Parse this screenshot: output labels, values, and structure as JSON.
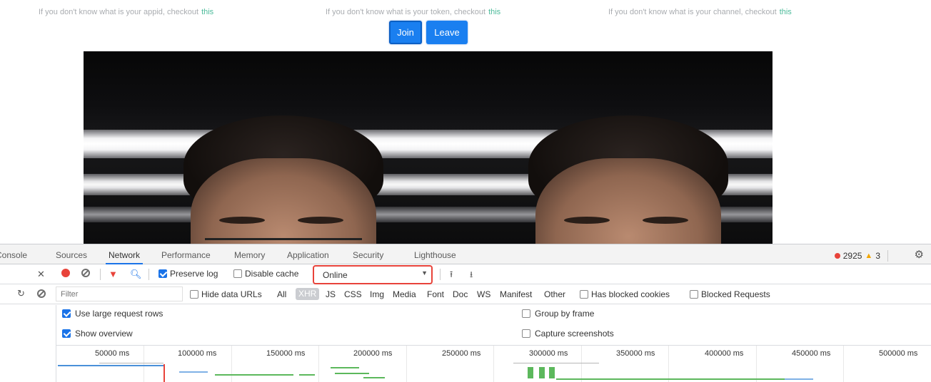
{
  "hints": {
    "appid": {
      "text": "If you don't know what is your appid, checkout",
      "link": "this"
    },
    "token": {
      "text": "If you don't know what is your token, checkout",
      "link": "this"
    },
    "channel": {
      "text": "If you don't know what is your channel, checkout",
      "link": "this"
    }
  },
  "buttons": {
    "join": "Join",
    "leave": "Leave"
  },
  "devtools": {
    "tabs": [
      "Console",
      "Sources",
      "Network",
      "Performance",
      "Memory",
      "Application",
      "Security",
      "Lighthouse"
    ],
    "active_tab": "Network",
    "errors": "2925",
    "warnings": "3",
    "toolbar": {
      "preserve_log": "Preserve log",
      "preserve_log_checked": true,
      "disable_cache": "Disable cache",
      "disable_cache_checked": false,
      "throttling": "Online"
    },
    "filterbar": {
      "filter_placeholder": "Filter",
      "hide_data_urls": "Hide data URLs",
      "types": [
        "All",
        "XHR",
        "JS",
        "CSS",
        "Img",
        "Media",
        "Font",
        "Doc",
        "WS",
        "Manifest",
        "Other"
      ],
      "active_type": "XHR",
      "has_blocked_cookies": "Has blocked cookies",
      "blocked_requests": "Blocked Requests"
    },
    "settings": {
      "use_large_rows": "Use large request rows",
      "show_overview": "Show overview",
      "group_by_frame": "Group by frame",
      "capture_screenshots": "Capture screenshots"
    },
    "timeline_ticks": [
      "50000 ms",
      "100000 ms",
      "150000 ms",
      "200000 ms",
      "250000 ms",
      "300000 ms",
      "350000 ms",
      "400000 ms",
      "450000 ms",
      "500000 ms"
    ]
  },
  "colors": {
    "accent": "#1a7ff0",
    "link": "#4dbb9b",
    "error": "#e8433a",
    "warning": "#f2a600",
    "devtools_blue": "#1a73e8"
  }
}
